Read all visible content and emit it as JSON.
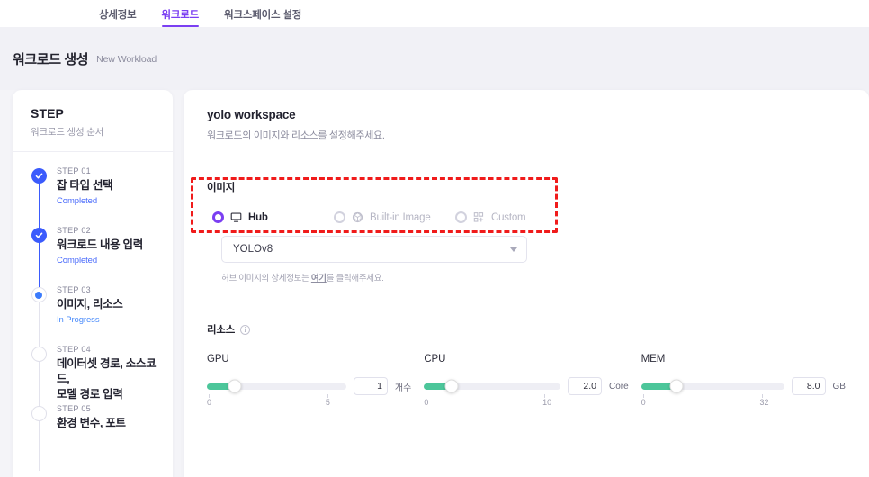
{
  "tabs": [
    {
      "label": "상세정보",
      "active": false
    },
    {
      "label": "워크로드",
      "active": true
    },
    {
      "label": "워크스페이스 설정",
      "active": false
    }
  ],
  "page_header": {
    "title": "워크로드 생성",
    "subtitle": "New Workload"
  },
  "sidebar": {
    "title": "STEP",
    "subtitle": "워크로드 생성 순서",
    "steps": [
      {
        "no": "STEP 01",
        "name": "잡 타입 선택",
        "state": "Completed",
        "status": "done"
      },
      {
        "no": "STEP 02",
        "name": "워크로드 내용 입력",
        "state": "Completed",
        "status": "done"
      },
      {
        "no": "STEP 03",
        "name": "이미지, 리소스",
        "state": "In Progress",
        "status": "current"
      },
      {
        "no": "STEP 04",
        "name": "데이터셋 경로, 소스코드,\n모델 경로 입력",
        "state": "",
        "status": "pending"
      },
      {
        "no": "STEP 05",
        "name": "환경 변수, 포트",
        "state": "",
        "status": "pending"
      }
    ]
  },
  "main": {
    "workspace_name": "yolo workspace",
    "description": "워크로드의 이미지와 리소스를 설정해주세요.",
    "image_section": {
      "label": "이미지",
      "options": [
        {
          "label": "Hub",
          "icon": "monitor-icon",
          "selected": true,
          "disabled": false
        },
        {
          "label": "Built-in Image",
          "icon": "cube-icon",
          "selected": false,
          "disabled": true
        },
        {
          "label": "Custom",
          "icon": "blocks-icon",
          "selected": false,
          "disabled": true
        }
      ],
      "select_value": "YOLOv8",
      "helper_prefix": "허브 이미지의 상세정보는 ",
      "helper_link": "여기",
      "helper_suffix": "를 클릭해주세요."
    },
    "resource_section": {
      "label": "리소스",
      "sliders": [
        {
          "name": "GPU",
          "value": "1",
          "unit": "개수",
          "min": "0",
          "max": "5",
          "pct": 20
        },
        {
          "name": "CPU",
          "value": "2.0",
          "unit": "Core",
          "min": "0",
          "max": "10",
          "pct": 20
        },
        {
          "name": "MEM",
          "value": "8.0",
          "unit": "GB",
          "min": "0",
          "max": "32",
          "pct": 25
        }
      ]
    }
  },
  "colors": {
    "accent_purple": "#7b3ff2",
    "step_blue": "#3b5bfc",
    "slider_green": "#4cc69a",
    "annotation_red": "#f01b1b"
  }
}
